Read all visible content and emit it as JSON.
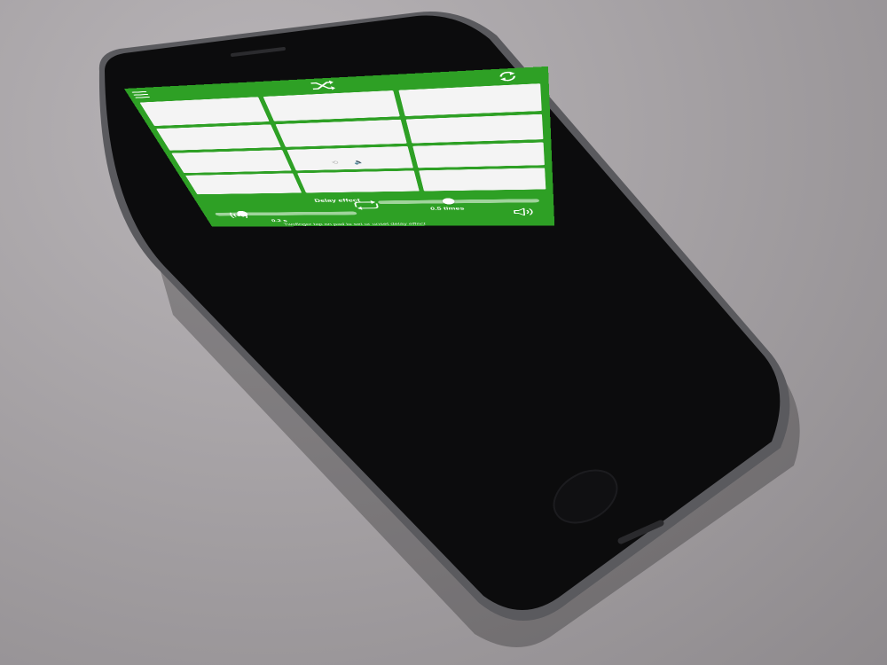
{
  "app": {
    "topbar": {
      "menu_icon": "menu-icon",
      "shuffle_icon": "shuffle-icon",
      "refresh_icon": "refresh-icon"
    },
    "pads": [
      {
        "id": 1,
        "icons": ""
      },
      {
        "id": 2,
        "icons": ""
      },
      {
        "id": 3,
        "icons": ""
      },
      {
        "id": 4,
        "icons": ""
      },
      {
        "id": 5,
        "icons": ""
      },
      {
        "id": 6,
        "icons": ""
      },
      {
        "id": 7,
        "icons": ""
      },
      {
        "id": 8,
        "icons": "⟲ 🔈"
      },
      {
        "id": 9,
        "icons": ""
      },
      {
        "id": 10,
        "icons": ""
      },
      {
        "id": 11,
        "icons": ""
      },
      {
        "id": 12,
        "icons": ""
      }
    ],
    "delay": {
      "title": "Delay effect",
      "time_value": "0.2 s",
      "time_level": 0.2,
      "feedback_value": "0.5 times",
      "feedback_level": 0.45,
      "hint": "Twofinger tap on pad to set or unset delay effect"
    },
    "bottom": {
      "speaker_icon": "speaker-icon",
      "loop_icon": "loop-icon",
      "wave_icon": "sound-wave-icon"
    },
    "colors": {
      "screen_green": "#2ea025",
      "pad_white": "#f4f4f4"
    }
  }
}
